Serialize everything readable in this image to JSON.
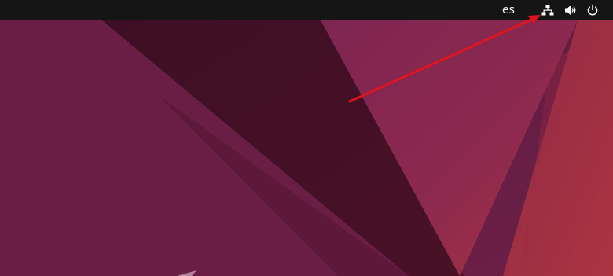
{
  "top_bar": {
    "keyboard_layout": "es",
    "icons": [
      "network-wired-icon",
      "volume-icon",
      "power-icon"
    ]
  },
  "colors": {
    "top_bar": "#151515",
    "wallpaper_base": "#4a1530",
    "annotation_arrow": "#e0141e"
  }
}
